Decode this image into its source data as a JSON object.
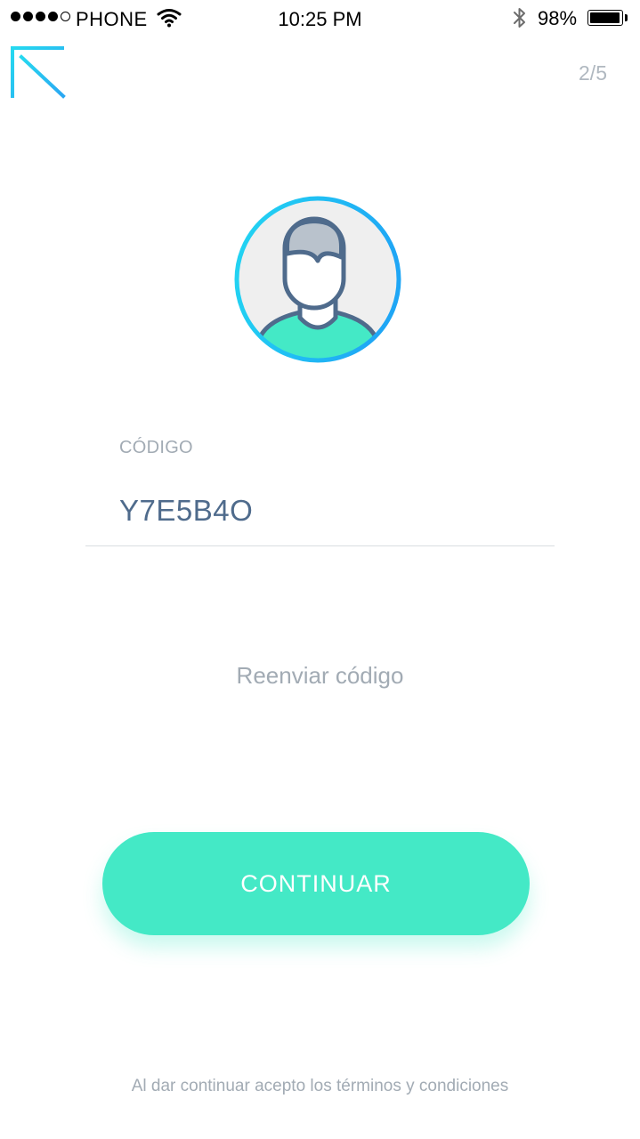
{
  "status_bar": {
    "carrier": "PHONE",
    "time": "10:25 PM",
    "battery_percent": "98%",
    "battery_level": 0.98,
    "signal_bars_filled": 4,
    "signal_bars_total": 5,
    "icons": [
      "signal-dots-icon",
      "wifi-icon",
      "bluetooth-icon",
      "battery-icon"
    ]
  },
  "header": {
    "back_icon": "back-arrow-icon",
    "step": "2/5"
  },
  "avatar": {
    "icon": "user-avatar-icon"
  },
  "form": {
    "code_label": "CÓDIGO",
    "code_value": "Y7E5B4O"
  },
  "resend_label": "Reenviar código",
  "continue_label": "CONTINUAR",
  "terms_text": "Al dar continuar acepto los términos y condiciones",
  "colors": {
    "accent": "#44e9c6",
    "avatar_ring_start": "#22d6f2",
    "avatar_ring_end": "#1fa6f5",
    "code_text": "#4f6b8c",
    "muted_text": "#a2abb4"
  }
}
